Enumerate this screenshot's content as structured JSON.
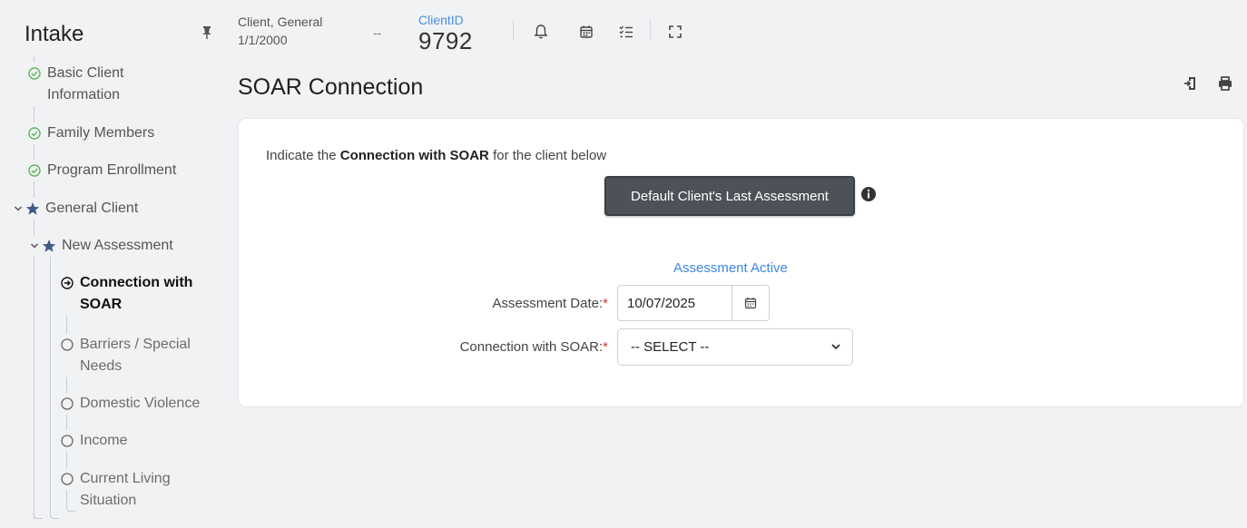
{
  "sidebar": {
    "title": "Intake",
    "items": [
      {
        "label": "Basic Client Information",
        "state": "done"
      },
      {
        "label": "Family Members",
        "state": "done"
      },
      {
        "label": "Program Enrollment",
        "state": "done"
      },
      {
        "label": "General Client",
        "state": "group"
      },
      {
        "label": "New Assessment",
        "state": "group"
      },
      {
        "label": "Connection with SOAR",
        "state": "active"
      },
      {
        "label": "Barriers / Special Needs",
        "state": "pending"
      },
      {
        "label": "Domestic Violence",
        "state": "pending"
      },
      {
        "label": "Income",
        "state": "pending"
      },
      {
        "label": "Current Living Situation",
        "state": "pending"
      }
    ]
  },
  "header": {
    "client_name": "Client, General",
    "client_dob": "1/1/2000",
    "separator": "--",
    "client_id_label": "ClientID",
    "client_id": "9792"
  },
  "page": {
    "title": "SOAR Connection"
  },
  "form": {
    "intro_prefix": "Indicate the ",
    "intro_bold": "Connection with SOAR",
    "intro_suffix": " for the client below",
    "default_button": "Default Client's Last Assessment",
    "status": "Assessment Active",
    "date_label": "Assessment Date:",
    "date_value": "10/07/2025",
    "connection_label": "Connection with SOAR:",
    "connection_value": "-- SELECT --",
    "required_mark": "*"
  },
  "colors": {
    "accent_blue": "#3d88e5",
    "done_green": "#5cb85c",
    "star": "#3f5a88",
    "button_dark": "#4d5259",
    "required_red": "#d9342b"
  },
  "icons": [
    "pin-icon",
    "check-circle-icon",
    "star-icon",
    "chevron-down-icon",
    "arrow-circle-icon",
    "circle-icon",
    "bell-icon",
    "calendar-icon",
    "checklist-icon",
    "expand-icon",
    "export-icon",
    "print-icon",
    "info-icon"
  ]
}
